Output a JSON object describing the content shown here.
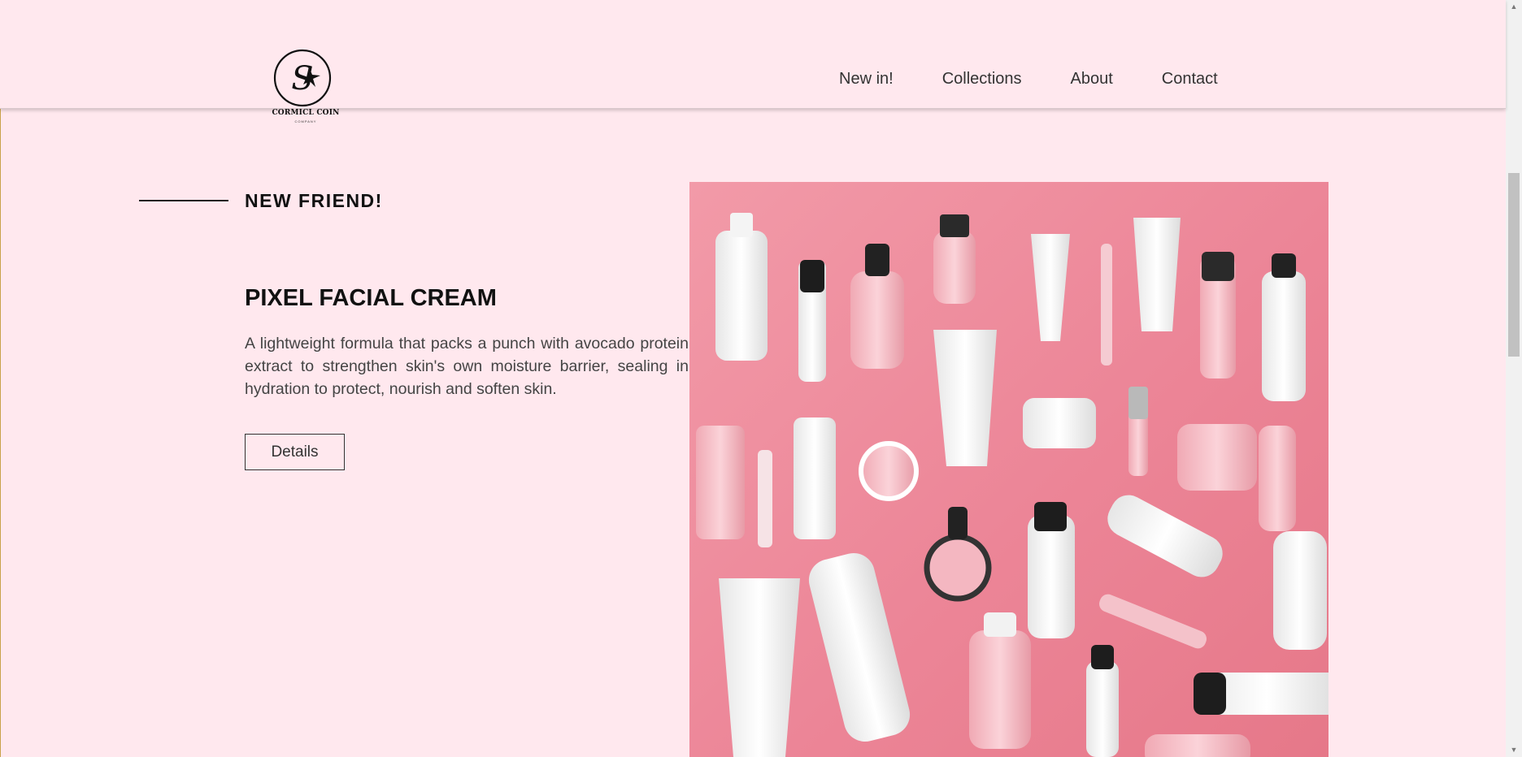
{
  "brand": {
    "monogram": "S",
    "wordmark": "CORMICL COIN",
    "tagline": "COMPANY"
  },
  "nav": {
    "items": [
      "New in!",
      "Collections",
      "About",
      "Contact"
    ]
  },
  "feature": {
    "eyebrow": "NEW FRIEND!",
    "title": "PIXEL FACIAL CREAM",
    "description": "A lightweight formula that packs a punch with avocado protein extract to strengthen skin's own moisture barrier, sealing in hydration to protect, nourish and soften skin.",
    "button_label": "Details"
  },
  "image": {
    "alt": "Flat-lay of pink and white skincare products"
  },
  "scrollbar": {
    "up_icon": "▲",
    "down_icon": "▼",
    "thumb_position": 0.25
  },
  "colors": {
    "background": "#ffe8ee",
    "hero_pink": "#ec8597",
    "text_dark": "#111111"
  }
}
